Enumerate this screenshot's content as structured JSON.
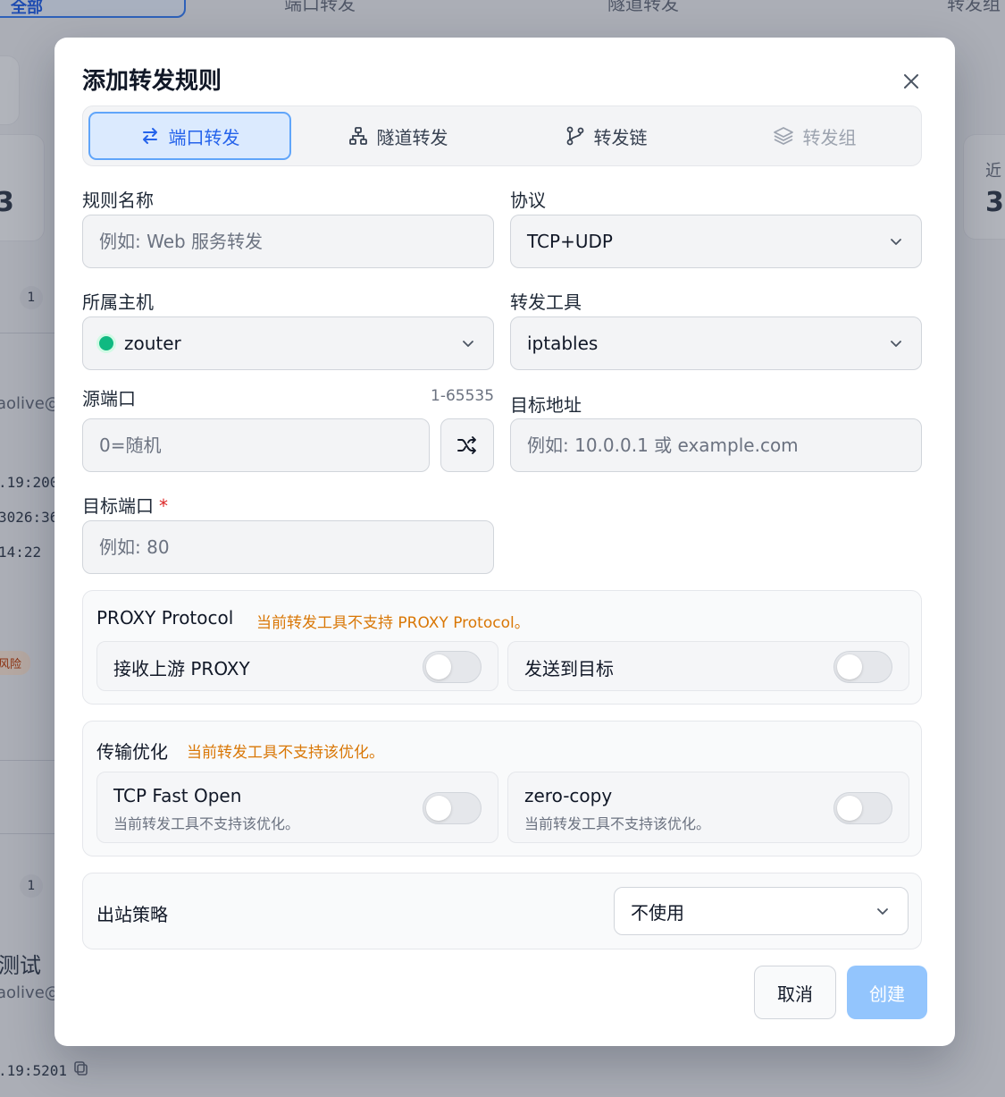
{
  "background": {
    "top_button_label": "全部",
    "tabs": [
      "端口转发",
      "隧道转发",
      "转发组"
    ],
    "stat_label": "近",
    "stat_value_left": "3",
    "stat_value_right": "3",
    "group_badge_1": "1",
    "group_badge_2": "1",
    "owner_text": "aolive@",
    "owner_text_2": "aolive@",
    "mono_lines": [
      ".19:200",
      "3026:36",
      "14:22"
    ],
    "risk_pill": "风险",
    "test_title": "测试",
    "address_bottom": ".19:5201"
  },
  "modal": {
    "title": "添加转发规则",
    "tabs": [
      {
        "label": "端口转发",
        "icon": "arrows-left-right-icon",
        "active": true
      },
      {
        "label": "隧道转发",
        "icon": "network-icon",
        "active": false
      },
      {
        "label": "转发链",
        "icon": "git-branch-icon",
        "active": false
      },
      {
        "label": "转发组",
        "icon": "layers-icon",
        "active": false,
        "disabled": true
      }
    ],
    "rule_name": {
      "label": "规则名称",
      "placeholder": "例如: Web 服务转发",
      "value": ""
    },
    "protocol": {
      "label": "协议",
      "value": "TCP+UDP"
    },
    "host": {
      "label": "所属主机",
      "value": "zouter",
      "status_color": "#10b981"
    },
    "forward_tool": {
      "label": "转发工具",
      "value": "iptables"
    },
    "source_port": {
      "label": "源端口",
      "hint": "1-65535",
      "placeholder": "0=随机"
    },
    "target_address": {
      "label": "目标地址",
      "placeholder": "例如: 10.0.0.1 或 example.com"
    },
    "target_port": {
      "label": "目标端口",
      "required_mark": "*",
      "placeholder": "例如: 80"
    },
    "proxy_protocol": {
      "title": "PROXY Protocol",
      "warning": "当前转发工具不支持 PROXY Protocol。",
      "receive_label": "接收上游 PROXY",
      "send_label": "发送到目标"
    },
    "transport": {
      "title": "传输优化",
      "warning": "当前转发工具不支持该优化。",
      "tfo_title": "TCP Fast Open",
      "tfo_sub": "当前转发工具不支持该优化。",
      "zerocopy_title": "zero-copy",
      "zerocopy_sub": "当前转发工具不支持该优化。"
    },
    "outbound": {
      "label": "出站策略",
      "value": "不使用"
    },
    "cancel_label": "取消",
    "create_label": "创建"
  },
  "colors": {
    "accent": "#2563eb",
    "warning": "#d97706",
    "online": "#10b981",
    "create_disabled": "#93c5fd"
  }
}
